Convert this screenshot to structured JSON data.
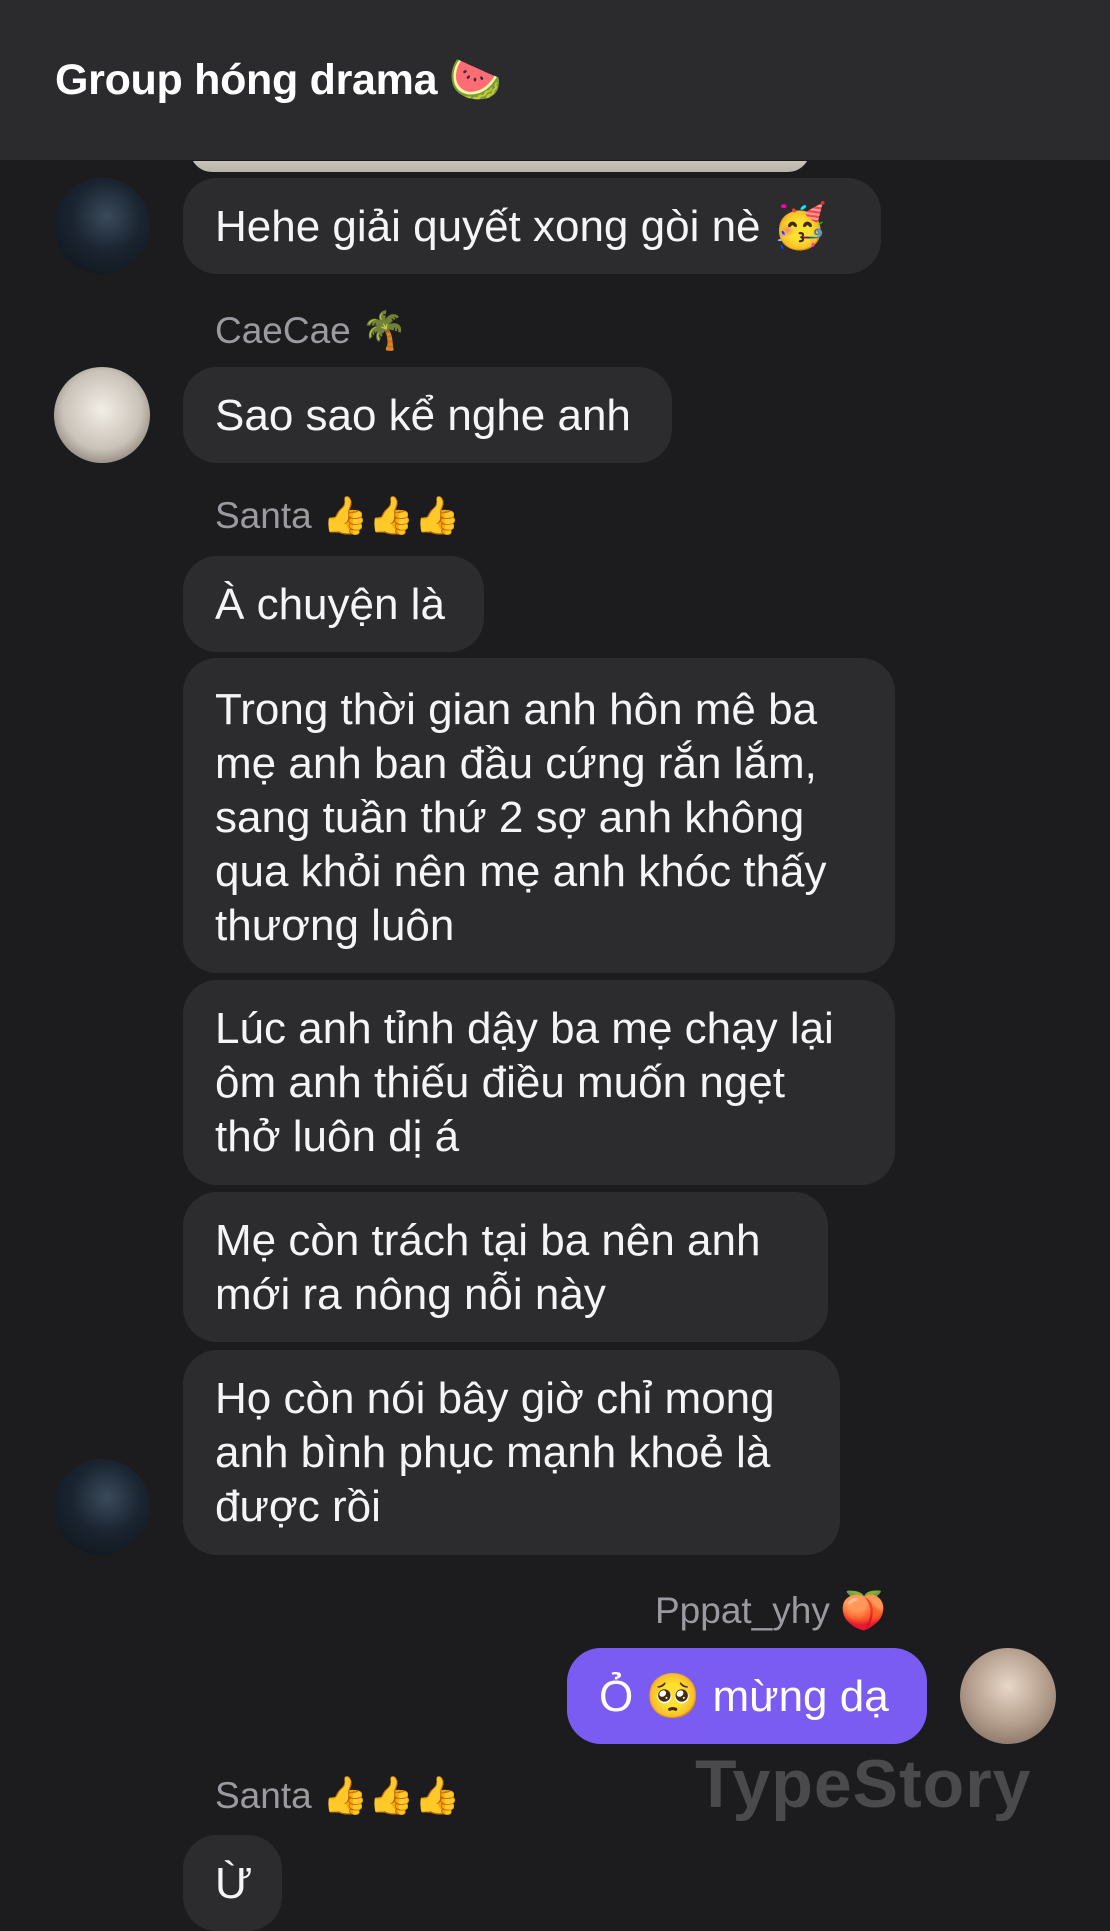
{
  "header": {
    "title": "Group hóng drama 🍉"
  },
  "messages": {
    "m1": "Hehe giải quyết xong gòi nè 🥳",
    "caecae_name": "CaeCae 🌴",
    "m2": "Sao sao kể nghe anh",
    "santa_name": "Santa 👍👍👍",
    "m3": "À chuyện là",
    "m4": [
      "Trong thời gian anh hôn mê ba",
      "mẹ anh ban đầu cứng rắn lắm,",
      "sang tuần thứ 2 sợ anh không",
      "qua khỏi nên mẹ anh khóc thấy",
      "thương luôn"
    ],
    "m5": [
      "Lúc anh tỉnh dậy ba mẹ chạy lại",
      "ôm anh thiếu điều muốn ngẹt",
      "thở luôn dị á"
    ],
    "m6": [
      "Mẹ còn trách tại ba nên anh",
      "mới ra nông nỗi này"
    ],
    "m7": [
      "Họ còn nói bây giờ chỉ mong",
      "anh bình phục mạnh khoẻ là",
      "được rồi"
    ],
    "me_name": "Pppat_yhy 🍑",
    "m8": "Ỏ 🥺 mừng dạ",
    "santa_name_2": "Santa 👍👍👍",
    "m9": "Ừ"
  },
  "watermark": "TypeStory"
}
